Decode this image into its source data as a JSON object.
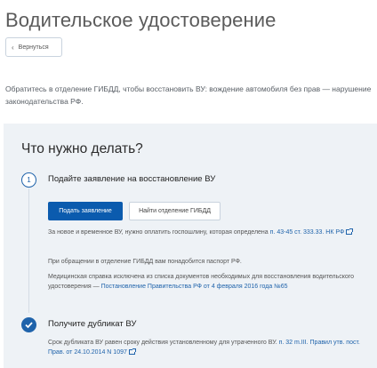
{
  "page": {
    "title": "Водительское удостоверение",
    "back_label": "Вернуться",
    "intro": "Обратитесь в отделение ГИБДД, чтобы восстановить ВУ: вождение автомобиля без прав — нарушение законодательства РФ."
  },
  "panel": {
    "title": "Что нужно делать?",
    "step1": {
      "number": "1",
      "title": "Подайте заявление на восстановление ВУ",
      "primary_button": "Подать заявление",
      "secondary_button": "Найти отделение ГИБДД",
      "fee_text": "За новое и временное ВУ, нужно оплатить госпошлину, которая определена",
      "fee_link": "п. 43-45 ст. 333.33. НК РФ",
      "passport_text": "При обращении в отделение ГИБДД вам понадобится паспорт РФ.",
      "medical_text": "Медицинская справка исключена из списка документов необходимых для восстановления водительского удостоверения —",
      "medical_link": "Постановление Правительства РФ от 4 февраля 2016 года №65"
    },
    "step2": {
      "title": "Получите дубликат ВУ",
      "text": "Срок дубликата ВУ равен сроку действия установленному для утраченного ВУ.",
      "link": "п. 32 m.III. Правил утв. пост. Прав. от 24.10.2014 N 1097"
    }
  },
  "colors": {
    "accent": "#0b5bae",
    "link": "#1f63ab",
    "panel_bg": "#eef2f6"
  }
}
